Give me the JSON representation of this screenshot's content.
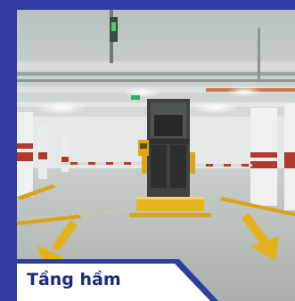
{
  "caption": {
    "label": "Tầng hầm"
  },
  "colors": {
    "frame_blue": "#2f3e9e",
    "caption_text": "#1f2a7a",
    "caption_bg": "#ffffff",
    "lane_arrow_yellow": "#e3b21b",
    "barrier_red": "#c0392b"
  },
  "photo": {
    "subject": "underground-parking-entrance",
    "elements": [
      "ceiling-pipes",
      "ceiling-lights",
      "pillars",
      "parking-booth",
      "barrier-gates",
      "yellow-lane-arrows",
      "speed-bump"
    ]
  }
}
